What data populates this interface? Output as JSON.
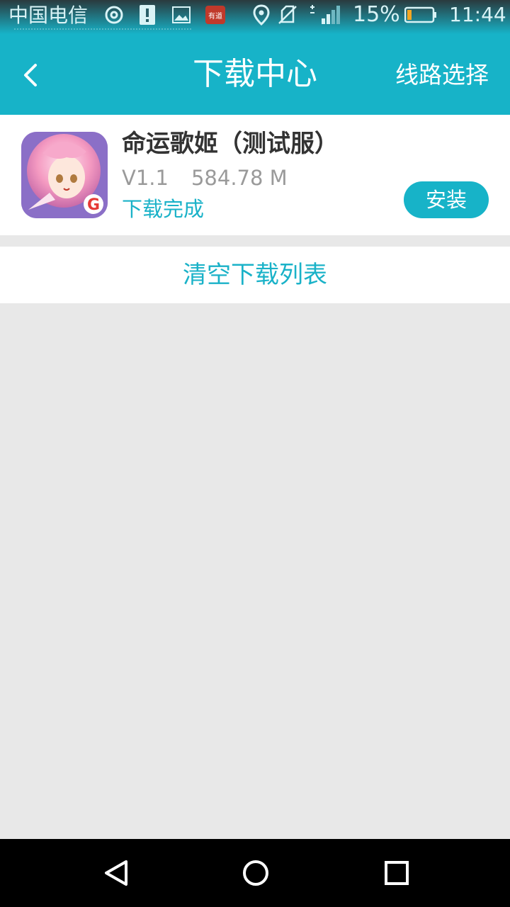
{
  "status_bar": {
    "carrier": "中国电信",
    "battery_percent": "15%",
    "time": "11:44",
    "notification_icon_text": "有道",
    "icons": [
      "sync-icon",
      "alert-icon",
      "image-icon",
      "youdao-icon",
      "location-icon",
      "no-sim-icon",
      "signal-icon",
      "battery-icon"
    ]
  },
  "header": {
    "title": "下载中心",
    "route_select": "线路选择",
    "back_icon": "chevron-left-icon",
    "background_color": "#17b3c8"
  },
  "downloads": [
    {
      "name": "命运歌姬（测试服）",
      "version": "V1.1",
      "size": "584.78 M",
      "status": "下载完成",
      "action": "安装",
      "badge_letter": "G"
    }
  ],
  "clear_list": "清空下载列表",
  "colors": {
    "accent": "#17b3c8",
    "title_text": "#333333",
    "meta_text": "#9a9a9a",
    "page_background": "#e8e8e8"
  },
  "nav_bar": {
    "buttons": [
      "back-triangle-icon",
      "home-circle-icon",
      "recents-square-icon"
    ]
  }
}
